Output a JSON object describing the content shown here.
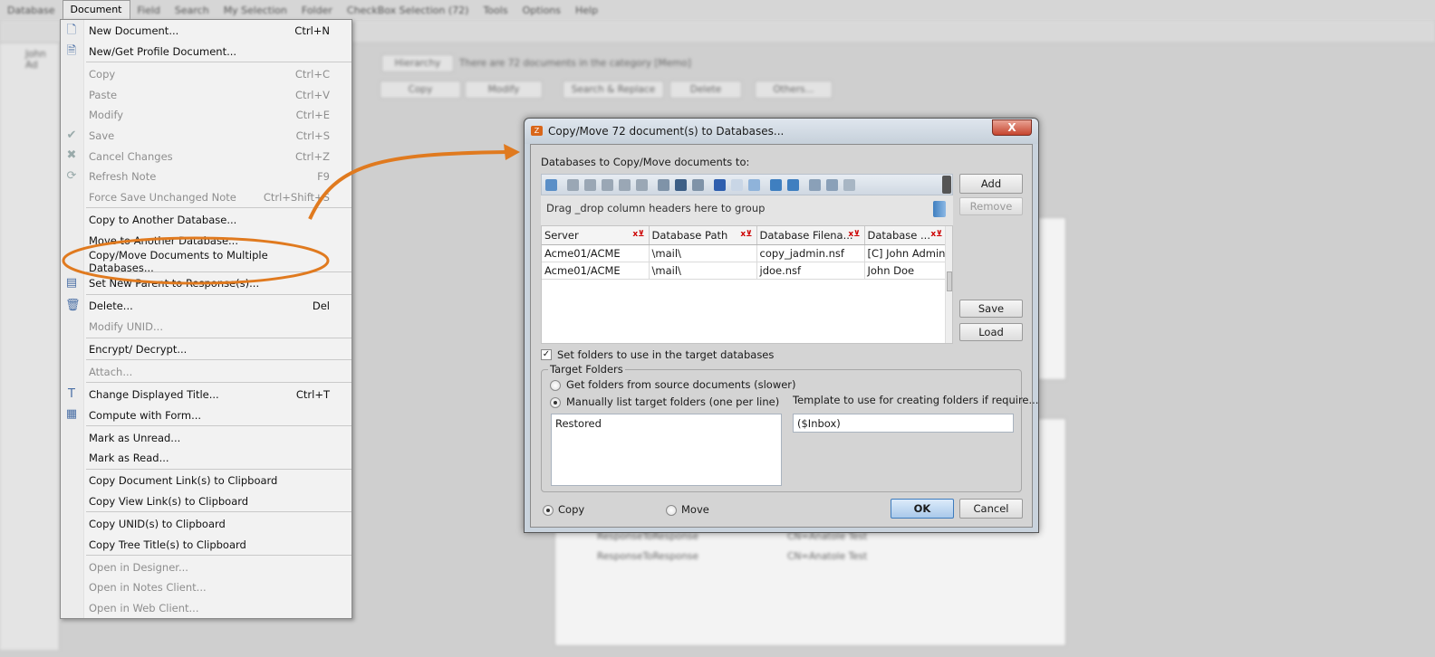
{
  "menubar": {
    "items": [
      "Database",
      "Document",
      "Field",
      "Search",
      "My Selection",
      "Folder",
      "CheckBox Selection (72)",
      "Tools",
      "Options",
      "Help"
    ],
    "active": "Document"
  },
  "background": {
    "tree_root": "John Ad",
    "hierarchy_label": "Hierarchy",
    "category_status": "There are 72 documents in the category [Memo]",
    "action_buttons": [
      "Copy",
      "Modify",
      "Search & Replace",
      "Delete",
      "Others..."
    ],
    "rows": [
      {
        "form": "ResponseToResponse",
        "author": "CN=Anatole Test"
      },
      {
        "form": "ResponseToResponse",
        "author": "CN=Anatole Test"
      }
    ]
  },
  "document_menu": {
    "groups": [
      [
        {
          "label": "New Document...",
          "shortcut": "Ctrl+N",
          "enabled": true,
          "icon": "new-document-icon"
        },
        {
          "label": "New/Get Profile Document...",
          "shortcut": "",
          "enabled": true,
          "icon": "profile-document-icon"
        }
      ],
      [
        {
          "label": "Copy",
          "shortcut": "Ctrl+C",
          "enabled": false
        },
        {
          "label": "Paste",
          "shortcut": "Ctrl+V",
          "enabled": false
        },
        {
          "label": "Modify",
          "shortcut": "Ctrl+E",
          "enabled": false
        },
        {
          "label": "Save",
          "shortcut": "Ctrl+S",
          "enabled": false,
          "icon": "checkmark-icon"
        },
        {
          "label": "Cancel Changes",
          "shortcut": "Ctrl+Z",
          "enabled": false,
          "icon": "x-icon"
        },
        {
          "label": "Refresh Note",
          "shortcut": "F9",
          "enabled": false,
          "icon": "refresh-icon"
        },
        {
          "label": "Force Save Unchanged Note",
          "shortcut": "Ctrl+Shift+S",
          "enabled": false
        }
      ],
      [
        {
          "label": "Copy to Another Database...",
          "shortcut": "",
          "enabled": true
        },
        {
          "label": "Move to Another Database...",
          "shortcut": "",
          "enabled": true
        },
        {
          "label": "Copy/Move Documents to Multiple Databases...",
          "shortcut": "",
          "enabled": true,
          "highlighted": true
        }
      ],
      [
        {
          "label": "Set New Parent to Response(s)...",
          "shortcut": "",
          "enabled": true,
          "icon": "set-parent-icon"
        }
      ],
      [
        {
          "label": "Delete...",
          "shortcut": "Del",
          "enabled": true,
          "icon": "trash-icon"
        },
        {
          "label": "Modify UNID...",
          "shortcut": "",
          "enabled": false
        }
      ],
      [
        {
          "label": "Encrypt/ Decrypt...",
          "shortcut": "",
          "enabled": true
        }
      ],
      [
        {
          "label": "Attach...",
          "shortcut": "",
          "enabled": false
        }
      ],
      [
        {
          "label": "Change Displayed Title...",
          "shortcut": "Ctrl+T",
          "enabled": true,
          "icon": "title-icon"
        },
        {
          "label": "Compute with Form...",
          "shortcut": "",
          "enabled": true,
          "icon": "form-icon"
        }
      ],
      [
        {
          "label": "Mark as Unread...",
          "shortcut": "",
          "enabled": true
        },
        {
          "label": "Mark as Read...",
          "shortcut": "",
          "enabled": true
        }
      ],
      [
        {
          "label": "Copy Document Link(s) to Clipboard",
          "shortcut": "",
          "enabled": true
        },
        {
          "label": "Copy View Link(s) to Clipboard",
          "shortcut": "",
          "enabled": true
        }
      ],
      [
        {
          "label": "Copy UNID(s) to Clipboard",
          "shortcut": "",
          "enabled": true
        },
        {
          "label": "Copy Tree Title(s) to Clipboard",
          "shortcut": "",
          "enabled": true
        }
      ],
      [
        {
          "label": "Open in Designer...",
          "shortcut": "",
          "enabled": false
        },
        {
          "label": "Open in Notes Client...",
          "shortcut": "",
          "enabled": false
        },
        {
          "label": "Open in Web Client...",
          "shortcut": "",
          "enabled": false
        }
      ]
    ]
  },
  "annotation": {
    "color": "#e07a1f"
  },
  "dialog": {
    "title": "Copy/Move 72 document(s) to Databases...",
    "close_label": "X",
    "databases_label": "Databases to Copy/Move documents to:",
    "group_hint": "Drag _drop column headers here to group",
    "columns": [
      "Server",
      "Database Path",
      "Database Filena...",
      "Database ..."
    ],
    "rows": [
      [
        "Acme01/ACME",
        "\\mail\\",
        "copy_jadmin.nsf",
        "[C] John Admin"
      ],
      [
        "Acme01/ACME",
        "\\mail\\",
        "jdoe.nsf",
        "John Doe"
      ]
    ],
    "buttons": {
      "add": "Add",
      "remove": "Remove",
      "save": "Save",
      "load": "Load",
      "ok": "OK",
      "cancel": "Cancel"
    },
    "set_folders_label": "Set folders to use in the target databases",
    "set_folders_checked": true,
    "target_folders_legend": "Target Folders",
    "radio_source": "Get folders from source documents (slower)",
    "radio_manual": "Manually list target folders (one per line)",
    "folder_mode": "manual",
    "folders_value": "Restored",
    "template_label": "Template to use for creating folders if require...",
    "template_value": "($Inbox)",
    "mode_copy": "Copy",
    "mode_move": "Move",
    "mode_selected": "Copy"
  }
}
